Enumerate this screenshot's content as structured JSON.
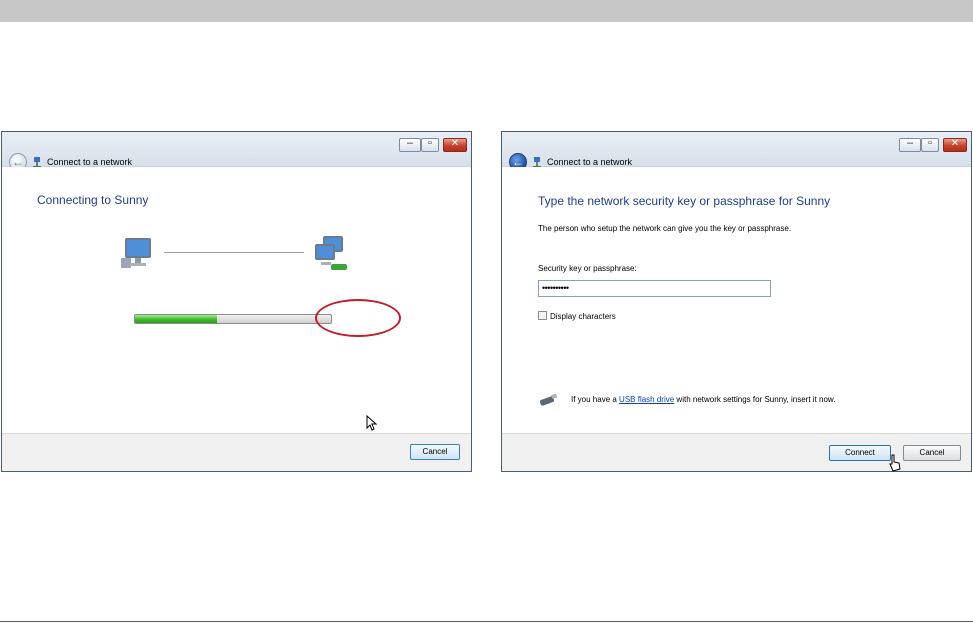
{
  "window1": {
    "title": "Connect to a network",
    "heading": "Connecting to Sunny",
    "progress_fraction": 0.42,
    "cancel_label": "Cancel"
  },
  "window2": {
    "title": "Connect to a network",
    "heading": "Type the network security key or passphrase for Sunny",
    "instruction": "The person who setup the network can give you the key or passphrase.",
    "key_label": "Security key or passphrase:",
    "key_value": "••••••••••",
    "display_chars_label": "Display characters",
    "usb_prefix": "If you have a",
    "usb_link": "USB flash drive",
    "usb_suffix": "with network settings for Sunny, insert it now.",
    "connect_label": "Connect",
    "cancel_label": "Cancel"
  },
  "colors": {
    "heading": "#1e3d8f",
    "highlight": "#c21f2b",
    "progress": "#3fbf2b"
  }
}
